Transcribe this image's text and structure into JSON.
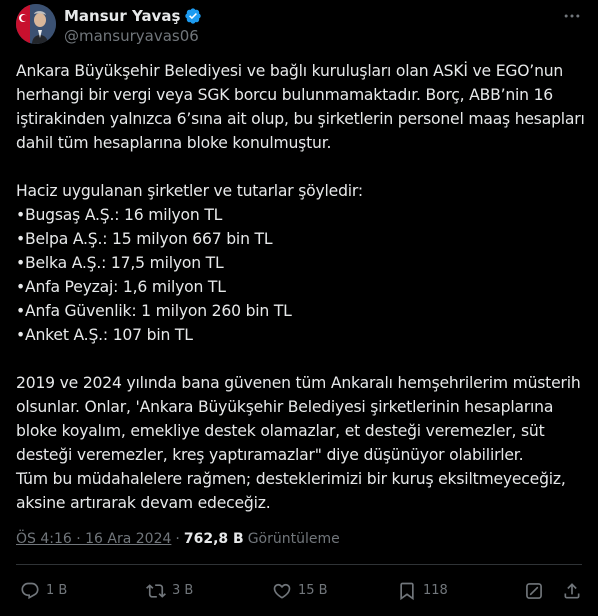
{
  "author": {
    "display_name": "Mansur Yavaş",
    "handle": "@mansuryavas06",
    "verified": true,
    "verified_color": "#1d9bf0"
  },
  "tweet": {
    "text": "Ankara Büyükşehir Belediyesi ve bağlı kuruluşları olan ASKİ ve EGO’nun herhangi bir vergi veya SGK borcu bulunmamaktadır. Borç, ABB’nin 16 iştirakinden yalnızca 6’sına ait olup, bu şirketlerin personel maaş hesapları dahil tüm hesaplarına bloke konulmuştur.\n\nHaciz uygulanan şirketler ve tutarlar şöyledir:\n•Bugsaş A.Ş.: 16 milyon TL\n•Belpa A.Ş.: 15 milyon 667 bin TL\n•Belka A.Ş.: 17,5 milyon TL\n•Anfa Peyzaj: 1,6 milyon TL\n•Anfa Güvenlik: 1 milyon 260 bin TL\n•Anket A.Ş.: 107 bin TL\n\n2019 ve 2024 yılında bana güvenen tüm Ankaralı hemşehrilerim müsterih olsunlar. Onlar, 'Ankara Büyükşehir Belediyesi şirketlerinin hesaplarına bloke koyalım, emekliye destek olamazlar, et desteği veremezler, süt desteği veremezler, kreş yaptıramazlar\" diye düşünüyor olabilirler.\nTüm bu müdahalelere rağmen; desteklerimizi bir kuruş eksiltmeyeceğiz, aksine artırarak devam edeceğiz."
  },
  "meta": {
    "time": "ÖS 4:16 · 16 Ara 2024",
    "separator": "·",
    "views": "762,8 B",
    "views_label": "Görüntüleme"
  },
  "actions": {
    "replies": "1 B",
    "reposts": "3 B",
    "likes": "15 B",
    "bookmarks": "118"
  },
  "icons": {
    "more": "more-horizontal-icon",
    "reply": "reply-bubble-icon",
    "repost": "repost-arrows-icon",
    "like": "heart-icon",
    "bookmark": "bookmark-icon",
    "grok": "grok-slash-icon",
    "share": "share-upload-icon"
  },
  "colors": {
    "background": "#000000",
    "text": "#e7e9ea",
    "secondary": "#71767b",
    "divider": "#2f3336"
  }
}
